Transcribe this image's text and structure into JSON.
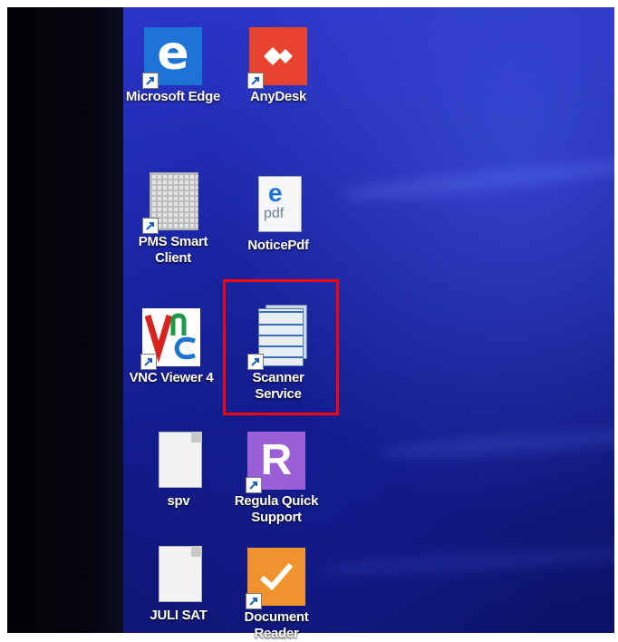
{
  "desktop": {
    "icons": [
      {
        "label": "Microsoft Edge",
        "icon": "edge-icon"
      },
      {
        "label": "AnyDesk",
        "icon": "anydesk-icon"
      },
      {
        "label": "PMS Smart Client",
        "icon": "document-grid-icon"
      },
      {
        "label": "NoticePdf",
        "icon": "edge-pdf-icon"
      },
      {
        "label": "VNC Viewer 4",
        "icon": "vnc-icon"
      },
      {
        "label": "Scanner Service",
        "icon": "text-document-icon"
      },
      {
        "label": "spv",
        "icon": "blank-document-icon"
      },
      {
        "label": "Regula Quick Support",
        "icon": "regula-icon"
      },
      {
        "label": "JULI SAT",
        "icon": "blank-document-icon"
      },
      {
        "label": "Document Reader",
        "icon": "checkmark-tile-icon"
      }
    ]
  },
  "highlight": {
    "target": "Scanner Service",
    "color": "#ff0000"
  },
  "colors": {
    "wallpaper": "#1c27a8",
    "edge": "#1e73d6",
    "anydesk": "#e8432f",
    "regula": "#9a5fd6",
    "document_reader": "#f0922e"
  }
}
